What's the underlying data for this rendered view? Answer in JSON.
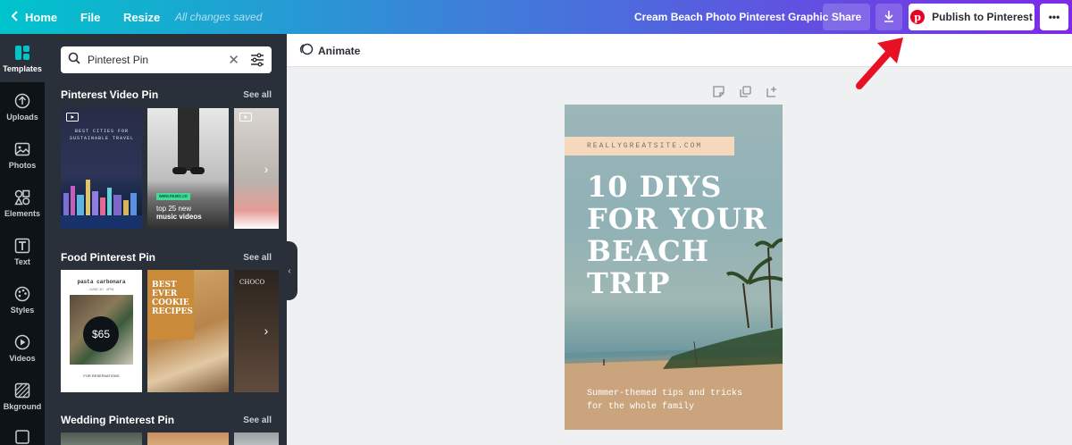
{
  "topbar": {
    "home_label": "Home",
    "file_label": "File",
    "resize_label": "Resize",
    "saved_status": "All changes saved",
    "document_title": "Cream Beach Photo Pinterest Graphic",
    "share_label": "Share",
    "publish_label": "Publish to Pinterest",
    "more_label": "•••"
  },
  "rail": {
    "items": [
      {
        "label": "Templates",
        "icon": "templates-icon"
      },
      {
        "label": "Uploads",
        "icon": "upload-icon"
      },
      {
        "label": "Photos",
        "icon": "photo-icon"
      },
      {
        "label": "Elements",
        "icon": "shapes-icon"
      },
      {
        "label": "Text",
        "icon": "text-icon"
      },
      {
        "label": "Styles",
        "icon": "palette-icon"
      },
      {
        "label": "Videos",
        "icon": "play-icon"
      },
      {
        "label": "Bkground",
        "icon": "background-icon"
      }
    ]
  },
  "panel": {
    "search_value": "Pinterest Pin",
    "sections": [
      {
        "title": "Pinterest Video Pin",
        "see_all": "See all"
      },
      {
        "title": "Food Pinterest Pin",
        "see_all": "See all"
      },
      {
        "title": "Wedding Pinterest Pin",
        "see_all": "See all"
      }
    ],
    "video_thumbs": {
      "t1_text": "BEST CITIES FOR SUSTAINABLE TRAVEL",
      "t2_tag": "www.music.co",
      "t2_line1": "top 25 new",
      "t2_line2": "music videos"
    },
    "food_thumbs": {
      "t1_title": "pasta carbonara",
      "t1_date": "JUNE 30 · 8PM",
      "t1_price": "$65",
      "t1_footer": "FOR RESERVATIONS",
      "t2_title": "BEST EVER COOKIE RECIPES",
      "t3_title": "CHOCO"
    }
  },
  "canvas": {
    "animate_label": "Animate"
  },
  "design": {
    "site": "REALLYGREATSITE.COM",
    "headline_lines": [
      "10 DIYS",
      "FOR YOUR",
      "BEACH",
      "TRIP"
    ],
    "sub_lines": [
      "Summer-themed tips and tricks",
      "for the whole family"
    ]
  },
  "colors": {
    "accent_red": "#e81123",
    "pinterest_red": "#e60023",
    "panel_bg": "#293039",
    "rail_bg": "#0e1318"
  }
}
